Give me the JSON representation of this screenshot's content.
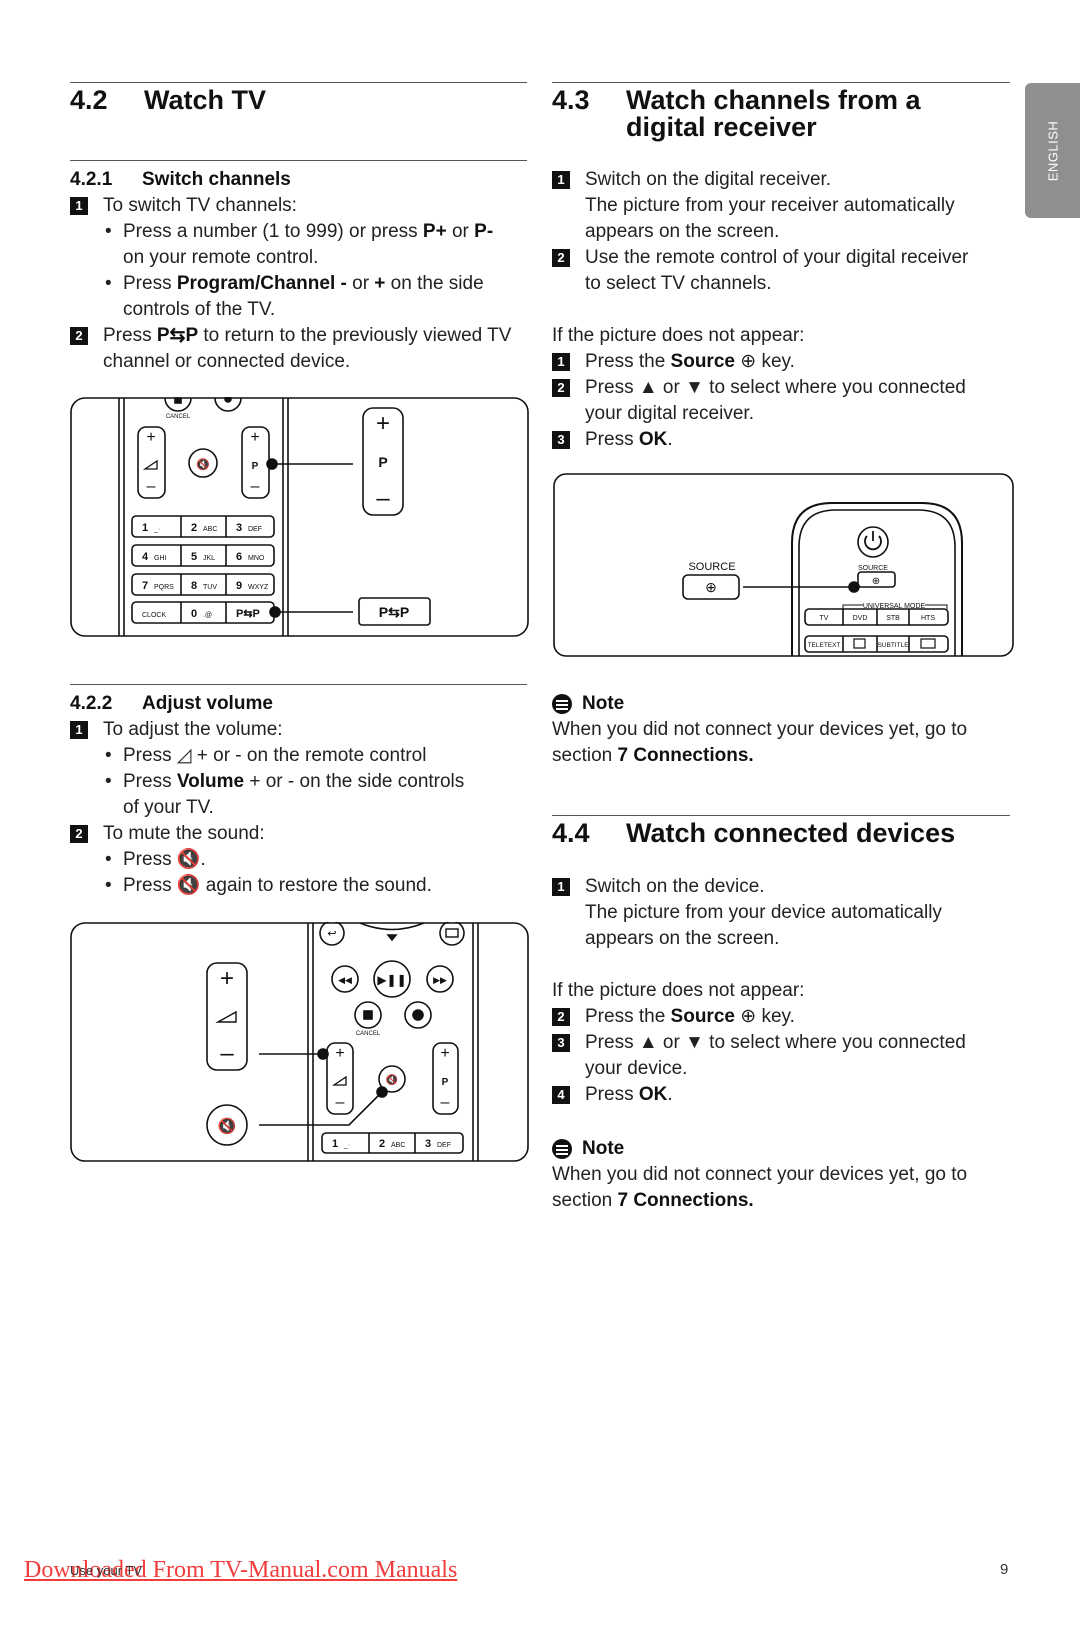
{
  "side_tab": "ENGLISH",
  "s42": {
    "num": "4.2",
    "title": "Watch TV"
  },
  "s421": {
    "num": "4.2.1",
    "title": "Switch channels",
    "step1": "To switch TV channels:",
    "b1a": "Press a number (1 to 999) or press ",
    "b1b": "P+",
    "b1c": " or ",
    "b1d": "P-",
    "b1e": "\non your remote control.",
    "b2a": "Press ",
    "b2b": "Program/Channel -",
    "b2c": " or ",
    "b2d": "+",
    "b2e": " on the side\ncontrols of the TV.",
    "step2a": "Press ",
    "step2b": "P⇆P",
    "step2c": " to return to the previously viewed TV\nchannel or connected device."
  },
  "diagram1": {
    "cancel": "CANCEL",
    "p": "P",
    "plus": "+",
    "minus": "–",
    "keys": [
      [
        "1",
        "_·"
      ],
      [
        "2",
        "ABC"
      ],
      [
        "3",
        "DEF"
      ],
      [
        "4",
        "GHI"
      ],
      [
        "5",
        "JKL"
      ],
      [
        "6",
        "MNO"
      ],
      [
        "7",
        "PQRS"
      ],
      [
        "8",
        "TUV"
      ],
      [
        "9",
        "WXYZ"
      ],
      [
        "",
        "CLOCK"
      ],
      [
        "0",
        ".@"
      ],
      [
        "P⇆P",
        ""
      ]
    ],
    "pp": "P⇆P"
  },
  "s422": {
    "num": "4.2.2",
    "title": "Adjust volume",
    "step1": "To adjust the volume:",
    "b1a": "Press ",
    "b1b": " + or - on the remote control",
    "b2a": "Press ",
    "b2b": "Volume",
    "b2c": " + or - on the side controls\nof your TV.",
    "step2": "To mute the sound:",
    "b3a": "Press ",
    "b3b": ".",
    "b4a": "Press ",
    "b4b": " again to restore the sound."
  },
  "diagram2": {
    "cancel": "CANCEL",
    "p": "P",
    "keys": [
      [
        "1",
        "_·"
      ],
      [
        "2",
        "ABC"
      ],
      [
        "3",
        "DEF"
      ]
    ]
  },
  "s43": {
    "num": "4.3",
    "title": "Watch channels from a\ndigital receiver",
    "step1": "Switch on the digital receiver.\nThe picture from your receiver automatically\nappears on the screen.",
    "step2": "Use the remote control of your digital receiver\nto select TV channels.",
    "intro": "If the picture does not appear:",
    "p1a": "Press the ",
    "p1b": "Source",
    "p1c": " key.",
    "p2a": "Press  ▲  or  ▼  to select where you connected\nyour digital receiver.",
    "p3a": "Press ",
    "p3b": "OK",
    "p3c": "."
  },
  "diagram3": {
    "source": "SOURCE",
    "universal": "UNIVERSAL MODE",
    "modes": [
      "TV",
      "DVD",
      "STB",
      "HTS"
    ],
    "row2": [
      "TELETEXT",
      "",
      "SUBTITLE",
      ""
    ]
  },
  "note1": {
    "title": "Note",
    "a": "When you did not connect your devices yet, go to\nsection ",
    "b": "7 Connections."
  },
  "s44": {
    "num": "4.4",
    "title": "Watch connected devices",
    "step1": "Switch on the device.\nThe picture from your device automatically\nappears on the screen.",
    "intro": "If the picture does not appear:",
    "p2a": "Press the ",
    "p2b": "Source",
    "p2c": " key.",
    "p3a": "Press  ▲  or  ▼  to select where you connected\nyour device.",
    "p4a": "Press ",
    "p4b": "OK",
    "p4c": "."
  },
  "note2": {
    "title": "Note",
    "a": "When you did not connect your devices yet, go to\nsection ",
    "b": "7 Connections."
  },
  "footer": {
    "link": "Downloaded From TV-Manual.com Manuals",
    "left": "Use your TV",
    "page": "9"
  }
}
